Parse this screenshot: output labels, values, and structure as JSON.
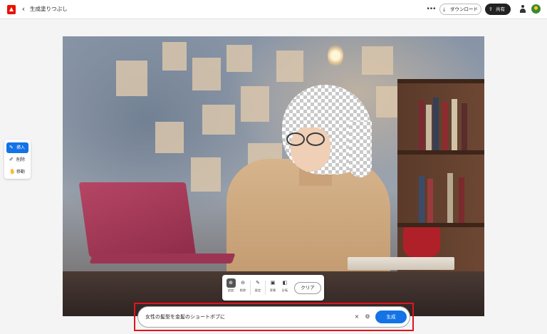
{
  "header": {
    "title": "生成塗りつぶし",
    "back_glyph": "‹",
    "more_glyph": "•••",
    "download_label": "ダウンロード",
    "download_glyph": "⤓",
    "share_label": "共有",
    "share_glyph": "⇧",
    "icons": [
      "app-logo-icon",
      "back-icon",
      "more-icon",
      "download-icon",
      "share-icon",
      "user-icon",
      "avatar"
    ]
  },
  "tools": {
    "items": [
      {
        "label": "挿入",
        "glyph": "✎",
        "active": true
      },
      {
        "label": "削除",
        "glyph": "✐",
        "active": false
      },
      {
        "label": "移動",
        "glyph": "✋",
        "active": false
      }
    ]
  },
  "sub_toolbar": {
    "buttons": [
      {
        "label": "追加",
        "glyph": "⊕",
        "selected": true
      },
      {
        "label": "削除",
        "glyph": "⊖",
        "selected": false
      },
      {
        "label": "設定",
        "glyph": "✎",
        "selected": false
      },
      {
        "label": "背景",
        "glyph": "▣",
        "selected": false
      },
      {
        "label": "反転",
        "glyph": "◧",
        "selected": false
      }
    ],
    "clear_label": "クリア"
  },
  "prompt": {
    "value": "女性の髪型を金髪のショートボブに",
    "clear_glyph": "×",
    "settings_glyph": "⚙",
    "generate_label": "生成"
  },
  "colors": {
    "accent": "#1473e6",
    "brand": "#eb1000",
    "highlight": "#e3131e"
  }
}
